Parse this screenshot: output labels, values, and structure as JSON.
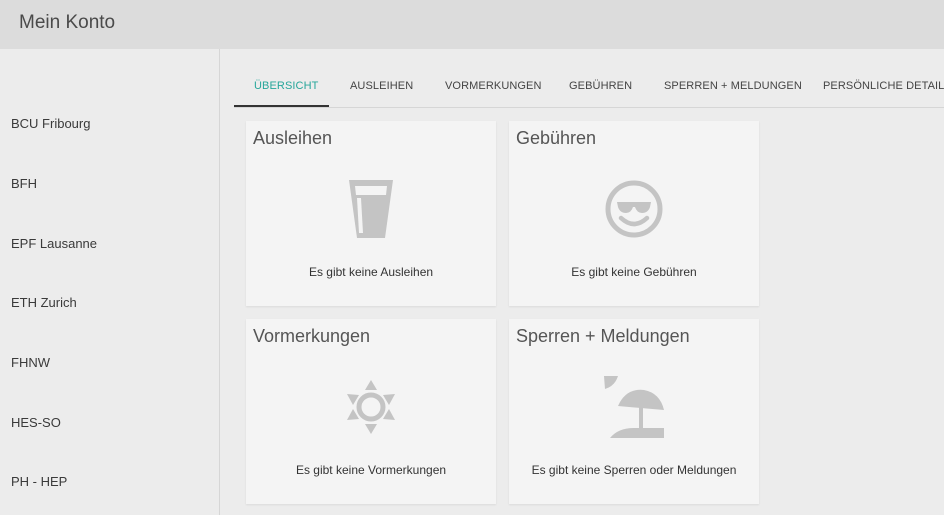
{
  "header": {
    "title": "Mein Konto"
  },
  "sidebar": {
    "items": [
      {
        "label": "BCU Fribourg"
      },
      {
        "label": "BFH"
      },
      {
        "label": "EPF Lausanne"
      },
      {
        "label": "ETH Zurich"
      },
      {
        "label": "FHNW"
      },
      {
        "label": "HES-SO"
      },
      {
        "label": "PH - HEP"
      }
    ]
  },
  "tabs": [
    {
      "label": "ÜBERSICHT",
      "active": true
    },
    {
      "label": "AUSLEIHEN"
    },
    {
      "label": "VORMERKUNGEN"
    },
    {
      "label": "GEBÜHREN"
    },
    {
      "label": "SPERREN + MELDUNGEN"
    },
    {
      "label": "PERSÖNLICHE DETAILS"
    }
  ],
  "cards": [
    {
      "title": "Ausleihen",
      "text": "Es gibt keine Ausleihen",
      "icon": "glass-icon"
    },
    {
      "title": "Gebühren",
      "text": "Es gibt keine Gebühren",
      "icon": "sunglasses-smiley-icon"
    },
    {
      "title": "Vormerkungen",
      "text": "Es gibt keine Vormerkungen",
      "icon": "sun-icon"
    },
    {
      "title": "Sperren + Meldungen",
      "text": "Es gibt keine Sperren oder Meldungen",
      "icon": "beach-umbrella-icon"
    }
  ],
  "colors": {
    "accent": "#26a69a",
    "header_bg": "#dcdcdc",
    "page_bg": "#ececec",
    "card_bg": "#f4f4f4",
    "icon": "#c4c4c4"
  }
}
